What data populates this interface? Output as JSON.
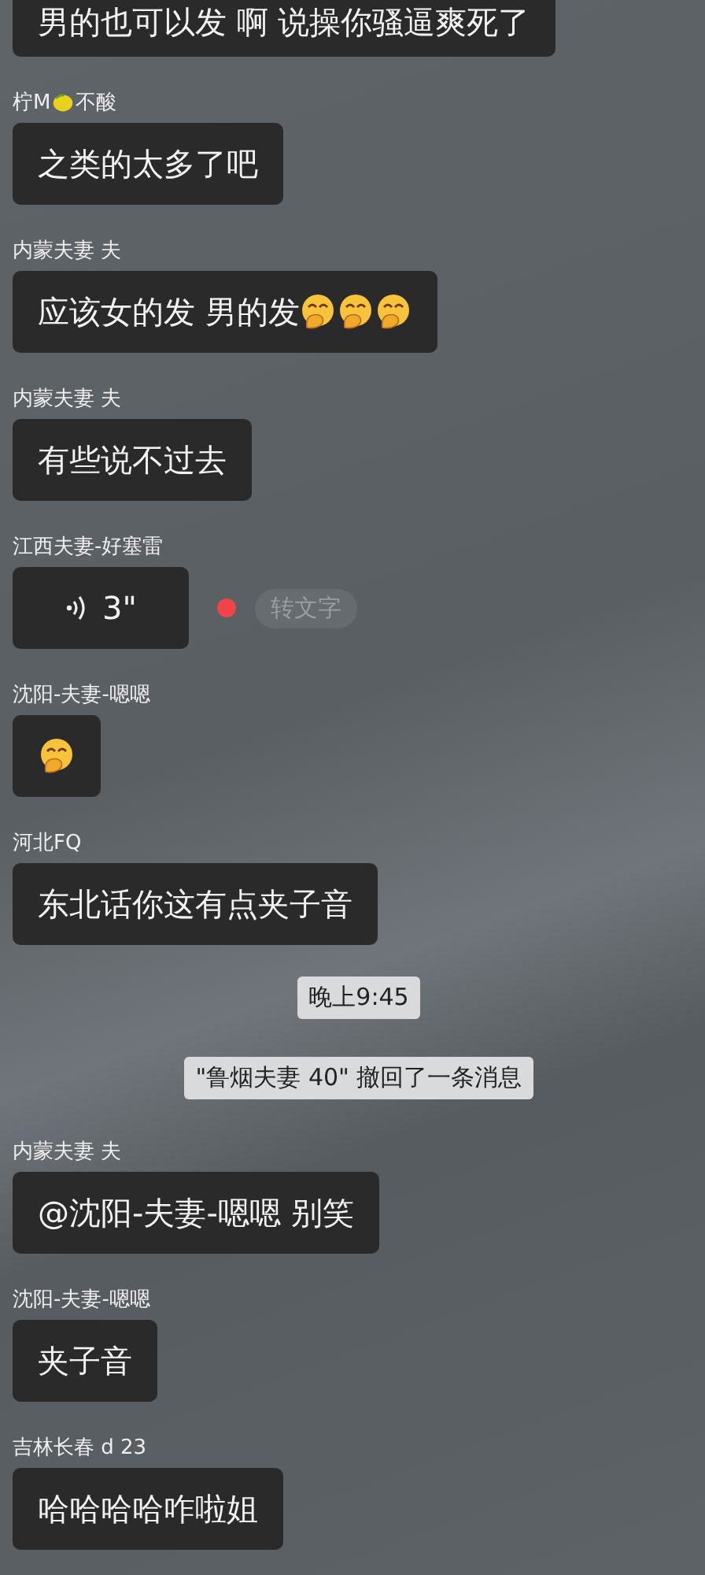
{
  "messages": [
    {
      "kind": "text",
      "text": "男的也可以发 啊 说操你骚逼爽死了"
    },
    {
      "kind": "text",
      "sender_parts": [
        "柠M",
        "不酸"
      ],
      "text": "之类的太多了吧"
    },
    {
      "kind": "text",
      "sender_parts": [
        "内蒙夫妻 夫"
      ],
      "text": "应该女的发 男的发",
      "trailing_icons": [
        {
          "kind": "giggle"
        },
        {
          "kind": "giggle"
        },
        {
          "kind": "giggle"
        }
      ]
    },
    {
      "kind": "text",
      "sender_parts": [
        "内蒙夫妻 夫"
      ],
      "text": "有些说不过去"
    },
    {
      "kind": "voice",
      "sender_parts": [
        "江西夫妻-好塞雷"
      ],
      "duration": "3\"",
      "unread": true,
      "convert_label": "转文字"
    },
    {
      "kind": "sticker",
      "sender_parts": [
        "沈阳-夫妻-嗯嗯"
      ]
    },
    {
      "kind": "text",
      "sender_parts": [
        "河北FQ"
      ],
      "text": "东北话你这有点夹子音"
    },
    {
      "kind": "time",
      "text": "晚上9:45"
    },
    {
      "kind": "notice",
      "text": "\"鲁烟夫妻 40\" 撤回了一条消息"
    },
    {
      "kind": "text",
      "sender_parts": [
        "内蒙夫妻 夫"
      ],
      "text": "@沈阳-夫妻-嗯嗯  别笑"
    },
    {
      "kind": "text",
      "sender_parts": [
        "沈阳-夫妻-嗯嗯"
      ],
      "text": "夹子音"
    },
    {
      "kind": "text",
      "sender_parts": [
        "吉林长春 d 23"
      ],
      "text": "哈哈哈哈咋啦姐"
    }
  ]
}
